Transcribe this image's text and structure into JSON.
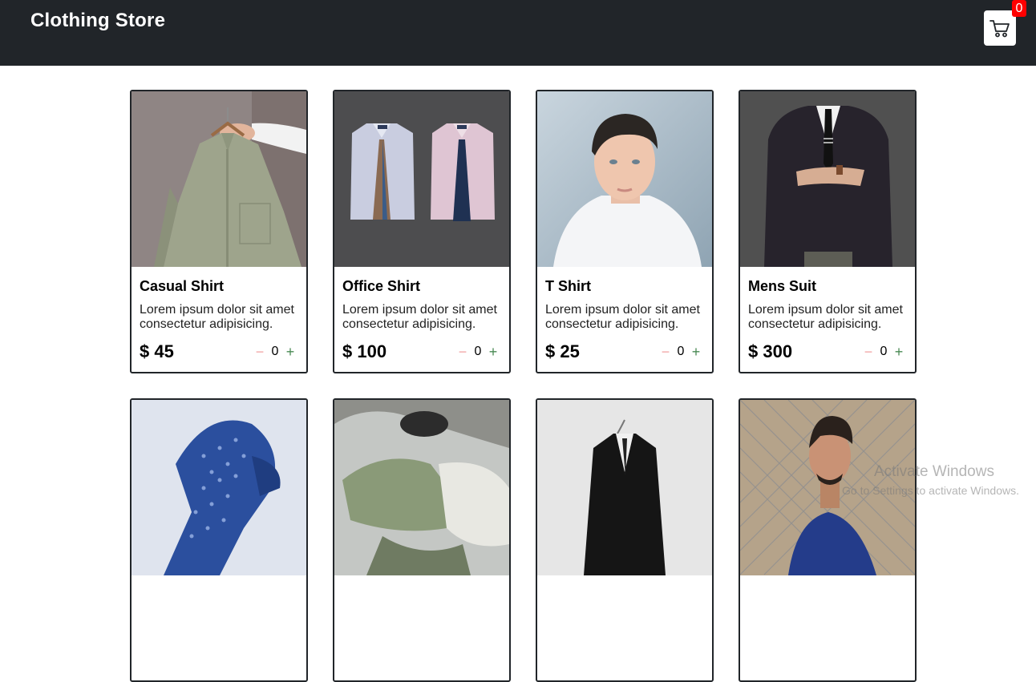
{
  "header": {
    "brand": "Clothing Store",
    "cart_count": "0"
  },
  "products": [
    {
      "title": "Casual Shirt",
      "desc": "Lorem ipsum dolor sit amet consectetur adipisicing.",
      "price": "$ 45",
      "qty": "0"
    },
    {
      "title": "Office Shirt",
      "desc": "Lorem ipsum dolor sit amet consectetur adipisicing.",
      "price": "$ 100",
      "qty": "0"
    },
    {
      "title": "T Shirt",
      "desc": "Lorem ipsum dolor sit amet consectetur adipisicing.",
      "price": "$ 25",
      "qty": "0"
    },
    {
      "title": "Mens Suit",
      "desc": "Lorem ipsum dolor sit amet consectetur adipisicing.",
      "price": "$ 300",
      "qty": "0"
    }
  ],
  "qty_controls": {
    "minus": "−",
    "plus": "+"
  },
  "watermark": {
    "line1": "Activate Windows",
    "line2": "Go to Settings to activate Windows."
  },
  "colors": {
    "header_bg": "#212529",
    "badge": "#ff0000",
    "minus": "#f1a3a3",
    "plus": "#4a8a55"
  },
  "icons": [
    "cart-icon"
  ]
}
